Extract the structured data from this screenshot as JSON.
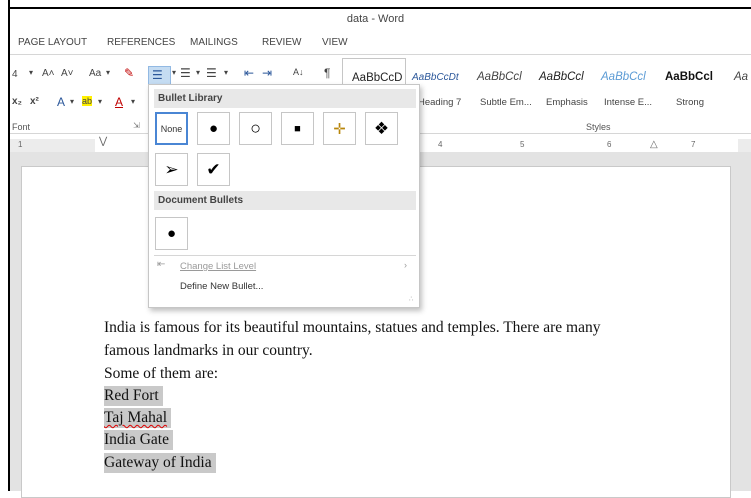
{
  "window": {
    "title": "data - Word"
  },
  "tabs": [
    "PAGE LAYOUT",
    "REFERENCES",
    "MAILINGS",
    "REVIEW",
    "VIEW"
  ],
  "font_group": {
    "size_value": "4",
    "grow_label": "A˄",
    "shrink_label": "A˅",
    "change_case_label": "Aa",
    "subscript_label": "x₂",
    "superscript_label": "x²",
    "text_effects_label": "A",
    "highlight_label": "ab",
    "font_color_label": "A",
    "group_label": "Font"
  },
  "paragraph_group": {
    "sort_label": "A↓",
    "pilcrow_label": "¶"
  },
  "styles_group": {
    "label": "Styles",
    "items": [
      {
        "preview": "AaBbCcD",
        "label": ""
      },
      {
        "preview": "AaBbCcDt",
        "label": "Heading 7"
      },
      {
        "preview": "AaBbCcl",
        "label": "Subtle Em..."
      },
      {
        "preview": "AaBbCcl",
        "label": "Emphasis"
      },
      {
        "preview": "AaBbCcl",
        "label": "Intense E..."
      },
      {
        "preview": "AaBbCcl",
        "label": "Strong"
      },
      {
        "preview": "Aa",
        "label": ""
      }
    ]
  },
  "ruler": {
    "numbers": [
      "1",
      "4",
      "5",
      "6",
      "7"
    ]
  },
  "bullet_menu": {
    "library_heading": "Bullet Library",
    "none_label": "None",
    "library_bullets": [
      "●",
      "○",
      "■",
      "✛",
      "❖",
      "➢",
      "✔"
    ],
    "document_heading": "Document Bullets",
    "document_bullets": [
      "●"
    ],
    "change_level_label": "Change List Level",
    "define_label": "Define New Bullet..."
  },
  "document": {
    "paragraph_lines": [
      "India is famous for its beautiful mountains, statues and temples. There are many",
      "famous landmarks in our country.",
      "Some of them are:"
    ],
    "list_items": [
      "Red Fort",
      "Taj Mahal",
      "India Gate",
      "Gateway of India"
    ]
  },
  "colors": {
    "accent": "#2b579a",
    "selection": "#c9c9c9",
    "library_selected_border": "#4a86d4"
  }
}
